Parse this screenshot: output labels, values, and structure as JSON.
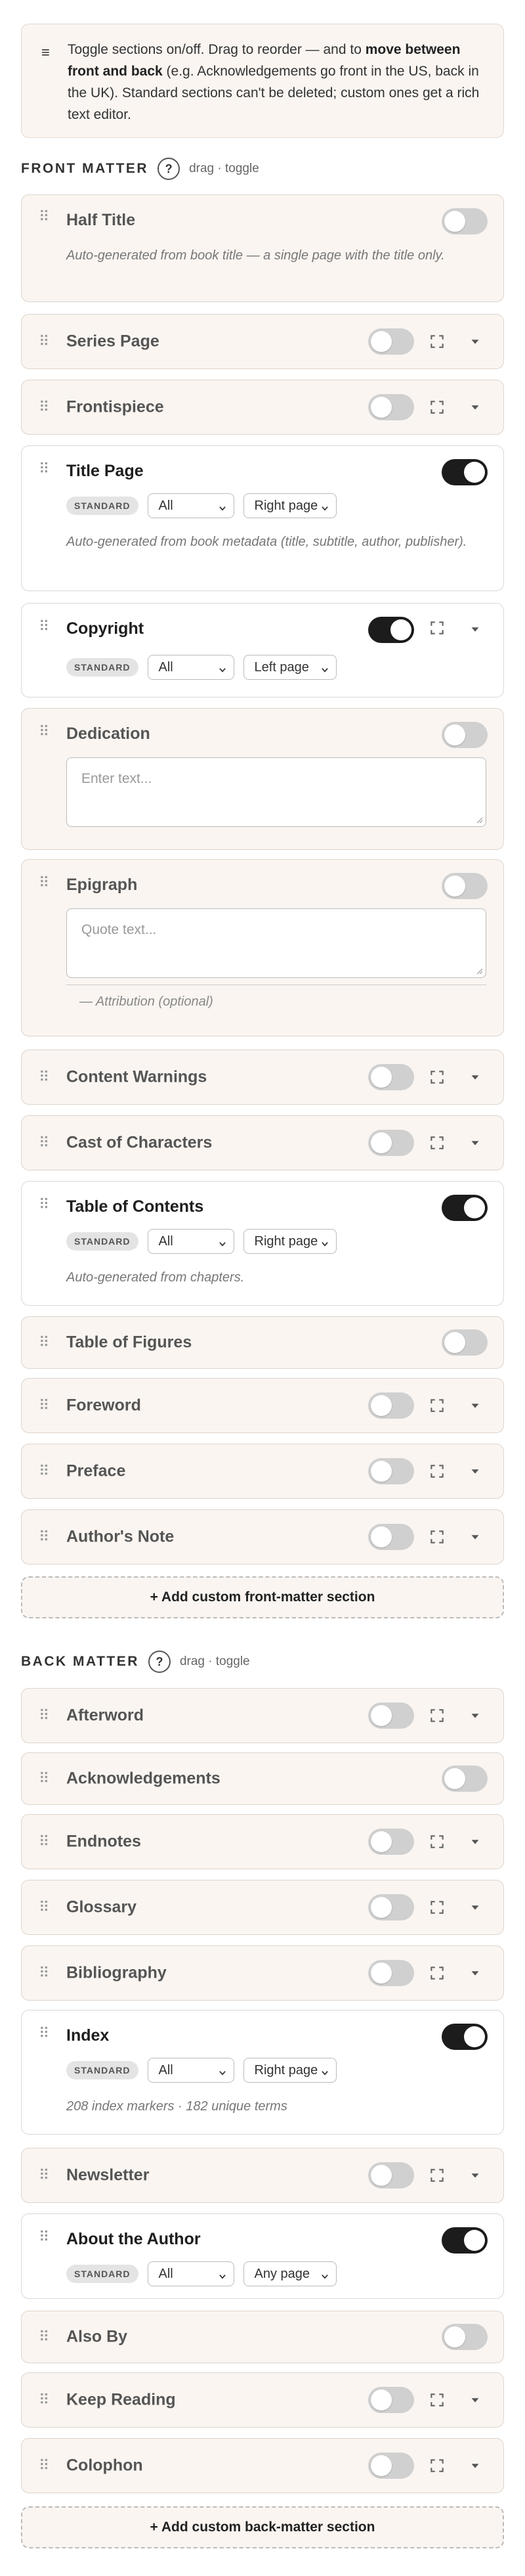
{
  "info": {
    "icon": "menu-icon",
    "text_1": "Toggle sections on/off. Drag to reorder — and to ",
    "bold": "move between front and back",
    "text_2": " (e.g. Acknowledgements go front in the US, back in the UK). Standard sections can't be deleted; custom ones get a rich text editor."
  },
  "front_matter": {
    "title": "FRONT MATTER",
    "help": "?",
    "hint": "drag · toggle",
    "add_label": "+ Add custom front-matter section",
    "sections": {
      "half_title": {
        "title": "Half Title",
        "enabled": false,
        "desc": "Auto-generated from book title — a single page with the title only."
      },
      "series_page": {
        "title": "Series Page",
        "enabled": false
      },
      "frontispiece": {
        "title": "Frontispiece",
        "enabled": false
      },
      "title_page": {
        "title": "Title Page",
        "enabled": true,
        "badge": "STANDARD",
        "select_1": "All",
        "select_2": "Right page",
        "desc": "Auto-generated from book metadata (title, subtitle, author, publisher)."
      },
      "copyright": {
        "title": "Copyright",
        "enabled": true,
        "badge": "STANDARD",
        "select_1": "All",
        "select_2": "Left page"
      },
      "dedication": {
        "title": "Dedication",
        "enabled": false,
        "placeholder": "Enter text..."
      },
      "epigraph": {
        "title": "Epigraph",
        "enabled": false,
        "placeholder": "Quote text...",
        "attribution": "— Attribution (optional)"
      },
      "content_warnings": {
        "title": "Content Warnings",
        "enabled": false
      },
      "cast": {
        "title": "Cast of Characters",
        "enabled": false
      },
      "toc": {
        "title": "Table of Contents",
        "enabled": true,
        "badge": "STANDARD",
        "select_1": "All",
        "select_2": "Right page",
        "desc": "Auto-generated from chapters."
      },
      "tof": {
        "title": "Table of Figures",
        "enabled": false
      },
      "foreword": {
        "title": "Foreword",
        "enabled": false
      },
      "preface": {
        "title": "Preface",
        "enabled": false
      },
      "authors_note": {
        "title": "Author's Note",
        "enabled": false
      }
    }
  },
  "back_matter": {
    "title": "BACK MATTER",
    "help": "?",
    "hint": "drag · toggle",
    "add_label": "+ Add custom back-matter section",
    "sections": {
      "afterword": {
        "title": "Afterword",
        "enabled": false
      },
      "acknowledgements": {
        "title": "Acknowledgements",
        "enabled": false
      },
      "endnotes": {
        "title": "Endnotes",
        "enabled": false
      },
      "glossary": {
        "title": "Glossary",
        "enabled": false
      },
      "bibliography": {
        "title": "Bibliography",
        "enabled": false
      },
      "index": {
        "title": "Index",
        "enabled": true,
        "badge": "STANDARD",
        "select_1": "All",
        "select_2": "Right page",
        "desc": "208 index markers · 182 unique terms"
      },
      "newsletter": {
        "title": "Newsletter",
        "enabled": false
      },
      "about_author": {
        "title": "About the Author",
        "enabled": true,
        "badge": "STANDARD",
        "select_1": "All",
        "select_2": "Any page"
      },
      "also_by": {
        "title": "Also By",
        "enabled": false
      },
      "keep_reading": {
        "title": "Keep Reading",
        "enabled": false
      },
      "colophon": {
        "title": "Colophon",
        "enabled": false
      }
    }
  },
  "icons": {
    "drag": "drag-handle-icon",
    "expand": "expand-icon",
    "chevron": "chevron-down-icon"
  },
  "colors": {
    "card_bg": "#faf5f1",
    "toggle_on": "#1c1c1c",
    "toggle_off": "#d0d0d0"
  }
}
